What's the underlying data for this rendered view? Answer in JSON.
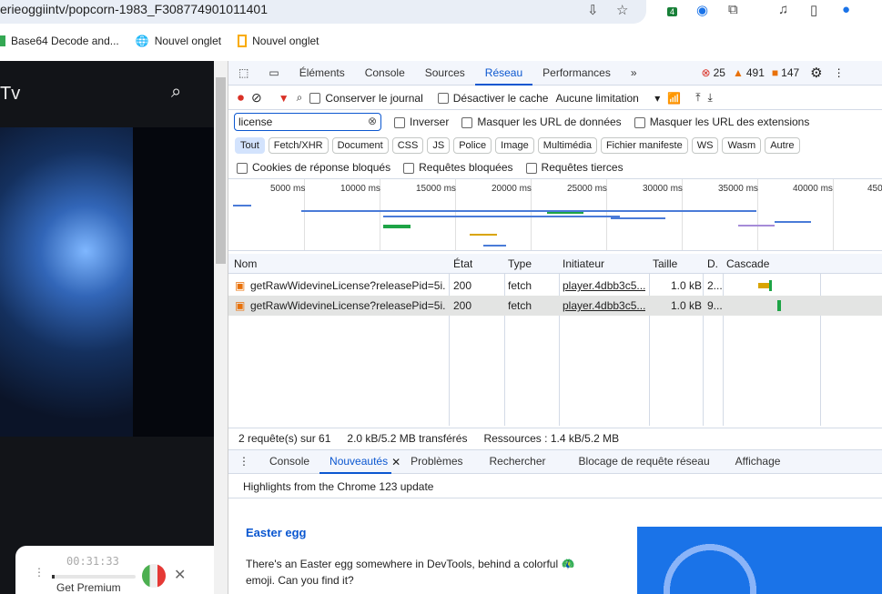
{
  "browser": {
    "url": "erieoggiintv/popcorn-1983_F308774901011401",
    "extension_badge": "4",
    "bookmarks": [
      {
        "label": "Base64 Decode and..."
      },
      {
        "label": "Nouvel onglet"
      },
      {
        "label": "Nouvel onglet"
      }
    ]
  },
  "page": {
    "title": "Tv",
    "timer": "00:31:33",
    "premium": "Get Premium",
    "progress": 0.03
  },
  "devtools": {
    "tabs": [
      "Éléments",
      "Console",
      "Sources",
      "Réseau",
      "Performances"
    ],
    "errors": "25",
    "warnings": "491",
    "issues": "147",
    "toolbar": {
      "preserve_log": "Conserver le journal",
      "disable_cache": "Désactiver le cache",
      "throttling": "Aucune limitation"
    },
    "filter": {
      "value": "license",
      "invert": "Inverser",
      "hide_data": "Masquer les URL de données",
      "hide_ext": "Masquer les URL des extensions"
    },
    "types": [
      "Tout",
      "Fetch/XHR",
      "Document",
      "CSS",
      "JS",
      "Police",
      "Image",
      "Multimédia",
      "Fichier manifeste",
      "WS",
      "Wasm",
      "Autre"
    ],
    "checks": [
      "Cookies de réponse bloqués",
      "Requêtes bloquées",
      "Requêtes tierces"
    ],
    "ticks": [
      "5000 ms",
      "10000 ms",
      "15000 ms",
      "20000 ms",
      "25000 ms",
      "30000 ms",
      "35000 ms",
      "40000 ms",
      "450"
    ],
    "columns": [
      "Nom",
      "État",
      "Type",
      "Initiateur",
      "Taille",
      "D.",
      "Cascade"
    ],
    "rows": [
      {
        "name": "getRawWidevineLicense?releasePid=5i...",
        "status": "200",
        "type": "fetch",
        "initiator": "player.4dbb3c5...",
        "size": "1.0 kB",
        "time": "2..."
      },
      {
        "name": "getRawWidevineLicense?releasePid=5i...",
        "status": "200",
        "type": "fetch",
        "initiator": "player.4dbb3c5...",
        "size": "1.0 kB",
        "time": "9..."
      }
    ],
    "status": {
      "requests": "2 requête(s) sur 61",
      "transferred": "2.0 kB/5.2 MB transférés",
      "resources": "Ressources : 1.4 kB/5.2 MB"
    },
    "drawer_tabs": [
      "Console",
      "Nouveautés",
      "Problèmes",
      "Rechercher",
      "Blocage de requête réseau",
      "Affichage"
    ],
    "highlights": "Highlights from the Chrome 123 update",
    "news": {
      "title": "Easter egg",
      "body": "There's an Easter egg somewhere in DevTools, behind a colorful 🦚 emoji. Can you find it?"
    }
  }
}
